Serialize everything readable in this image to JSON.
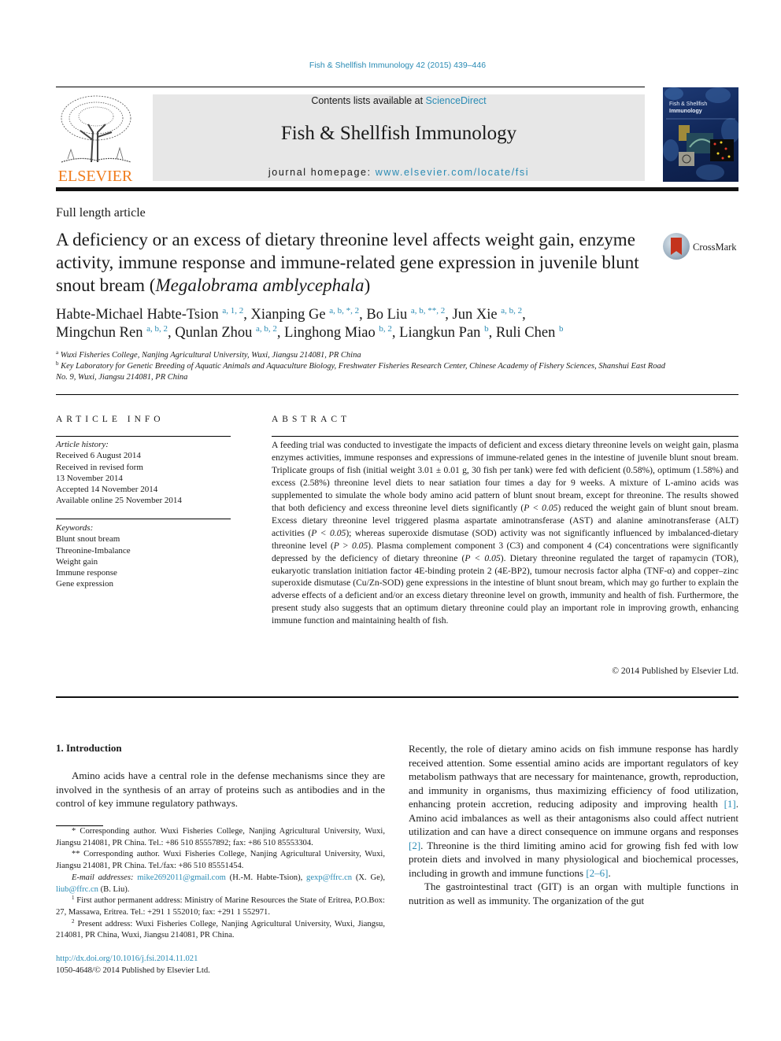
{
  "header": {
    "journal_reference": "Fish & Shellfish Immunology 42 (2015) 439–446",
    "contents_prefix": "Contents lists available at ",
    "contents_link": "ScienceDirect",
    "journal_name": "Fish & Shellfish Immunology",
    "homepage_prefix": "journal homepage: ",
    "homepage_link": "www.elsevier.com/locate/fsi",
    "publisher_logo": "ELSEVIER",
    "cover_title_line1": "Fish & Shellfish",
    "cover_title_line2": "Immunology",
    "colors": {
      "link": "#2a8bb4",
      "elsevier_orange": "#f07c1c",
      "banner_bg": "#e7e7e7"
    }
  },
  "article": {
    "type": "Full length article",
    "title_main": "A deficiency or an excess of dietary threonine level affects weight gain, enzyme activity, immune response and immune-related gene expression in juvenile blunt snout bream (",
    "title_species": "Megalobrama amblycephala",
    "title_end": ")",
    "crossmark_label": "CrossMark",
    "authors": [
      {
        "name": "Habte-Michael Habte-Tsion",
        "marks": "a, 1, 2"
      },
      {
        "name": "Xianping Ge",
        "marks": "a, b, *, 2"
      },
      {
        "name": "Bo Liu",
        "marks": "a, b, **, 2"
      },
      {
        "name": "Jun Xie",
        "marks": "a, b, 2"
      },
      {
        "name": "Mingchun Ren",
        "marks": "a, b, 2"
      },
      {
        "name": "Qunlan Zhou",
        "marks": "a, b, 2"
      },
      {
        "name": "Linghong Miao",
        "marks": "b, 2"
      },
      {
        "name": "Liangkun Pan",
        "marks": "b"
      },
      {
        "name": "Ruli Chen",
        "marks": "b"
      }
    ],
    "affiliations": [
      {
        "mark": "a",
        "text": "Wuxi Fisheries College, Nanjing Agricultural University, Wuxi, Jiangsu 214081, PR China"
      },
      {
        "mark": "b",
        "text": "Key Laboratory for Genetic Breeding of Aquatic Animals and Aquaculture Biology, Freshwater Fisheries Research Center, Chinese Academy of Fishery Sciences, Shanshui East Road No. 9, Wuxi, Jiangsu 214081, PR China"
      }
    ]
  },
  "article_info": {
    "heading": "ARTICLE INFO",
    "history_label": "Article history:",
    "history": [
      "Received 6 August 2014",
      "Received in revised form",
      "13 November 2014",
      "Accepted 14 November 2014",
      "Available online 25 November 2014"
    ],
    "keywords_label": "Keywords:",
    "keywords": [
      "Blunt snout bream",
      "Threonine-Imbalance",
      "Weight gain",
      "Immune response",
      "Gene expression"
    ]
  },
  "abstract": {
    "heading": "ABSTRACT",
    "p1": "A feeding trial was conducted to investigate the impacts of deficient and excess dietary threonine levels on weight gain, plasma enzymes activities, immune responses and expressions of immune-related genes in the intestine of juvenile blunt snout bream. Triplicate groups of fish (initial weight 3.01 ± 0.01 g, 30 fish per tank) were fed with deficient (0.58%), optimum (1.58%) and excess (2.58%) threonine level diets to near satiation four times a day for 9 weeks. A mixture of L-amino acids was supplemented to simulate the whole body amino acid pattern of blunt snout bream, except for threonine. The results showed that both deficiency and excess threonine level diets significantly (",
    "pval1": "P < 0.05",
    "p2": ") reduced the weight gain of blunt snout bream. Excess dietary threonine level triggered plasma aspartate aminotransferase (AST) and alanine aminotransferase (ALT) activities (",
    "pval2": "P < 0.05",
    "p3": "); whereas superoxide dismutase (SOD) activity was not significantly influenced by imbalanced-dietary threonine level (",
    "pval3": "P > 0.05",
    "p4": "). Plasma complement component 3 (C3) and component 4 (C4) concentrations were significantly depressed by the deficiency of dietary threonine (",
    "pval4": "P < 0.05",
    "p5": "). Dietary threonine regulated the target of rapamycin (TOR), eukaryotic translation initiation factor 4E-binding protein 2 (4E-BP2), tumour necrosis factor alpha (TNF-α) and copper–zinc superoxide dismutase (Cu/Zn-SOD) gene expressions in the intestine of blunt snout bream, which may go further to explain the adverse effects of a deficient and/or an excess dietary threonine level on growth, immunity and health of fish. Furthermore, the present study also suggests that an optimum dietary threonine could play an important role in improving growth, enhancing immune function and maintaining health of fish.",
    "copyright": "© 2014 Published by Elsevier Ltd."
  },
  "body": {
    "intro_heading": "1.  Introduction",
    "left_paragraph": "Amino acids have a central role in the defense mechanisms since they are involved in the synthesis of an array of proteins such as antibodies and in the control of key immune regulatory pathways.",
    "right_p1_a": "Recently, the role of dietary amino acids on fish immune response has hardly received attention. Some essential amino acids are important regulators of key metabolism pathways that are necessary for maintenance, growth, reproduction, and immunity in organisms, thus maximizing efficiency of food utilization, enhancing protein accretion, reducing adiposity and improving health ",
    "ref1": "[1]",
    "right_p1_b": ". Amino acid imbalances as well as their antagonisms also could affect nutrient utilization and can have a direct consequence on immune organs and responses ",
    "ref2": "[2]",
    "right_p1_c": ". Threonine is the third limiting amino acid for growing fish fed with low protein diets and involved in many physiological and biochemical processes, including in growth and immune functions ",
    "ref3": "[2–6]",
    "right_p1_d": ".",
    "right_p2": "The gastrointestinal tract (GIT) is an organ with multiple functions in nutrition as well as immunity. The organization of the gut"
  },
  "footnotes": {
    "fn_star": "* Corresponding author. Wuxi Fisheries College, Nanjing Agricultural University, Wuxi, Jiangsu 214081, PR China. Tel.: +86 510 85557892; fax: +86 510 85553304.",
    "fn_star2": "** Corresponding author. Wuxi Fisheries College, Nanjing Agricultural University, Wuxi, Jiangsu 214081, PR China. Tel./fax: +86 510 85551454.",
    "email_label": "E-mail addresses:",
    "email1": "mike2692011@gmail.com",
    "email1_owner": " (H.-M. Habte-Tsion), ",
    "email2": "gexp@ffrc.cn",
    "email2_owner": " (X. Ge), ",
    "email3": "liub@ffrc.cn",
    "email3_owner": " (B. Liu).",
    "fn1_mark": "1",
    "fn1": " First author permanent address: Ministry of Marine Resources the State of Eritrea, P.O.Box: 27, Massawa, Eritrea. Tel.: +291 1 552010; fax: +291 1 552971.",
    "fn2_mark": "2",
    "fn2": " Present address: Wuxi Fisheries College, Nanjing Agricultural University, Wuxi, Jiangsu, 214081, PR China, Wuxi, Jiangsu 214081, PR China."
  },
  "doi": {
    "link": "http://dx.doi.org/10.1016/j.fsi.2014.11.021",
    "issn": "1050-4648/© 2014 Published by Elsevier Ltd."
  }
}
